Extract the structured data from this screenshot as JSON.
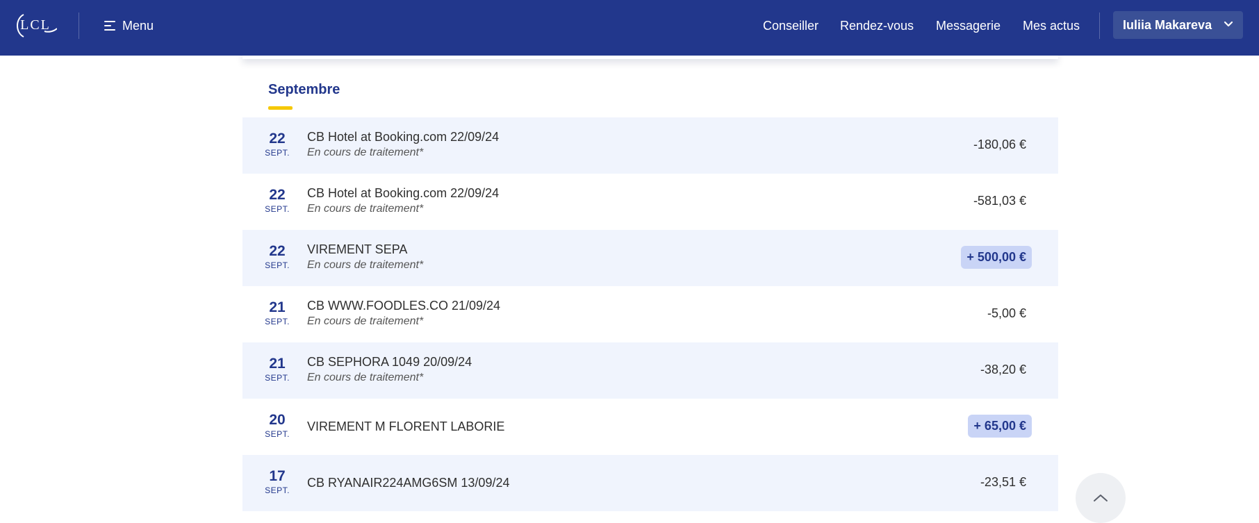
{
  "header": {
    "logo_text": "LCL",
    "menu_label": "Menu",
    "nav": [
      "Conseiller",
      "Rendez-vous",
      "Messagerie",
      "Mes actus"
    ],
    "user_name": "Iuliia Makareva",
    "colors": {
      "bar": "#22378c",
      "user_button": "#3a5096"
    }
  },
  "section": {
    "month": "Septembre",
    "accent": "#f5c800"
  },
  "transactions": [
    {
      "day": "22",
      "month": "SEPT.",
      "label": "CB Hotel at Booking.com 22/09/24",
      "status": "En cours de traitement*",
      "amount": "-180,06 €",
      "positive": false
    },
    {
      "day": "22",
      "month": "SEPT.",
      "label": "CB Hotel at Booking.com 22/09/24",
      "status": "En cours de traitement*",
      "amount": "-581,03 €",
      "positive": false
    },
    {
      "day": "22",
      "month": "SEPT.",
      "label": "VIREMENT SEPA",
      "status": "En cours de traitement*",
      "amount": "+ 500,00 €",
      "positive": true
    },
    {
      "day": "21",
      "month": "SEPT.",
      "label": "CB WWW.FOODLES.CO 21/09/24",
      "status": "En cours de traitement*",
      "amount": "-5,00 €",
      "positive": false
    },
    {
      "day": "21",
      "month": "SEPT.",
      "label": "CB SEPHORA 1049 20/09/24",
      "status": "En cours de traitement*",
      "amount": "-38,20 €",
      "positive": false
    },
    {
      "day": "20",
      "month": "SEPT.",
      "label": "VIREMENT M FLORENT LABORIE",
      "status": "",
      "amount": "+ 65,00 €",
      "positive": true
    },
    {
      "day": "17",
      "month": "SEPT.",
      "label": "CB RYANAIR224AMG6SM 13/09/24",
      "status": "",
      "amount": "-23,51 €",
      "positive": false
    }
  ],
  "icons": {
    "menu": "menu-icon",
    "user_dropdown": "chevron-down-icon",
    "scroll_top": "chevron-up-icon"
  }
}
